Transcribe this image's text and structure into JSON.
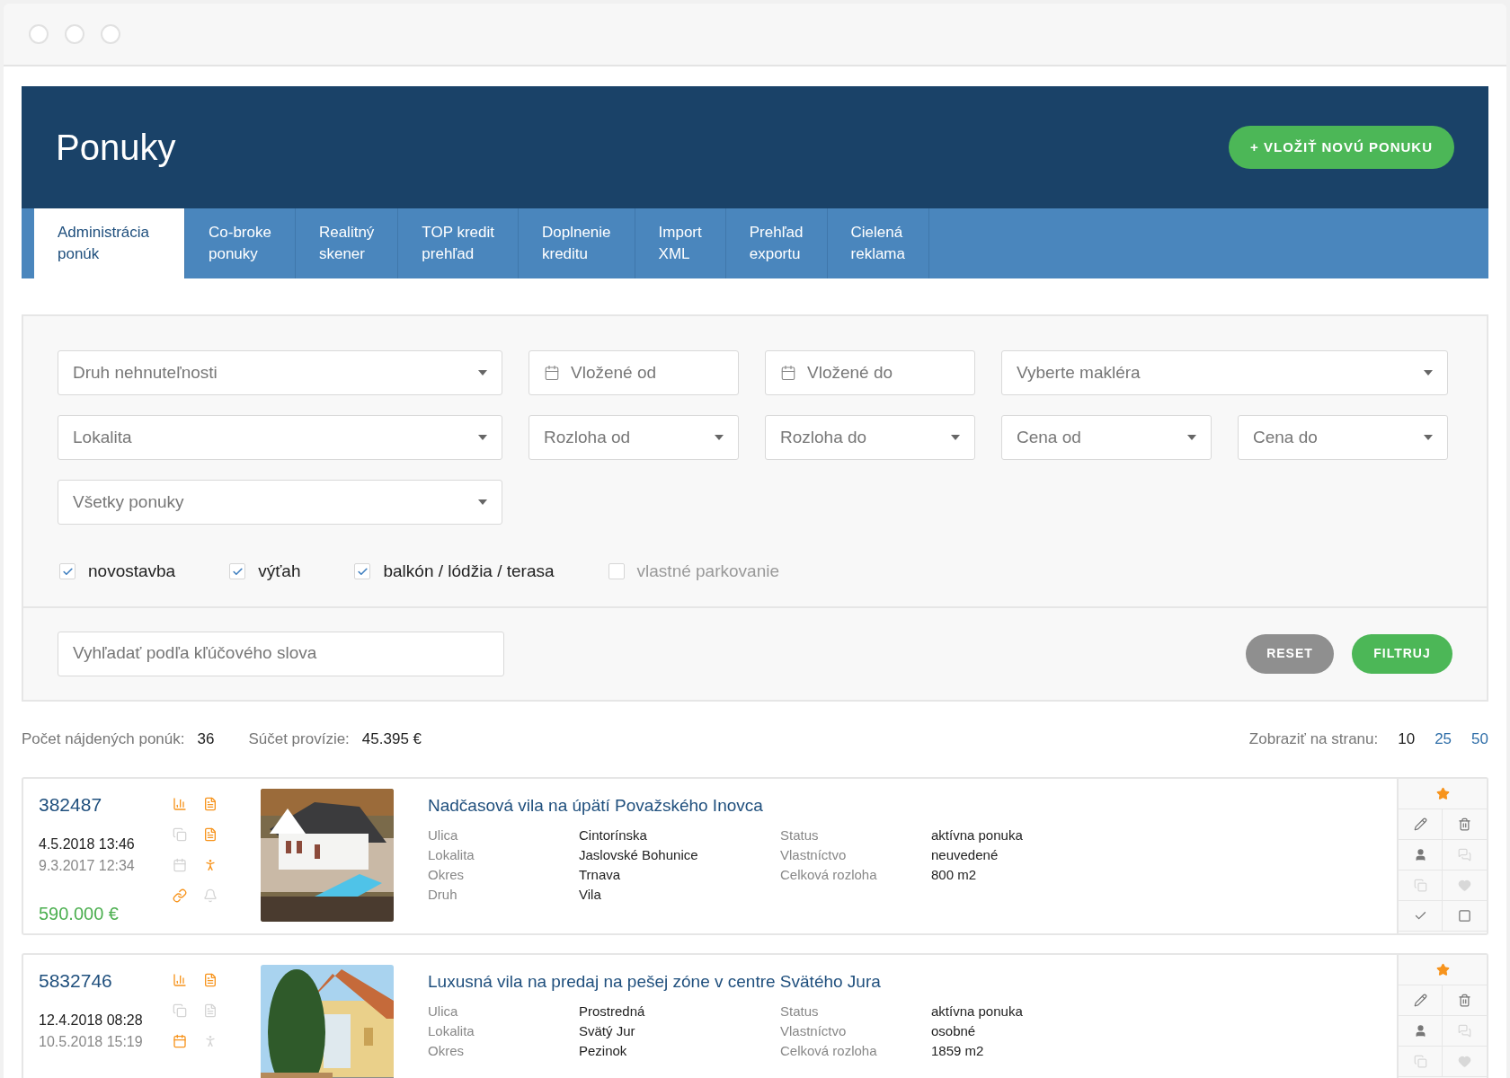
{
  "header": {
    "title": "Ponuky",
    "add_button": "+ VLOŽIŤ NOVÚ PONUKU"
  },
  "tabs": [
    {
      "label": "Administrácia\nponúk",
      "selected": true
    },
    {
      "label": "Co-broke\nponuky",
      "selected": false
    },
    {
      "label": "Realitný\nskener",
      "selected": false
    },
    {
      "label": "TOP kredit\nprehľad",
      "selected": false
    },
    {
      "label": "Doplnenie\nkreditu",
      "selected": false
    },
    {
      "label": "Import\nXML",
      "selected": false
    },
    {
      "label": "Prehľad\nexportu",
      "selected": false
    },
    {
      "label": "Cielená\nreklama",
      "selected": false
    }
  ],
  "filters": {
    "rows": [
      [
        {
          "kind": "select",
          "placeholder": "Druh nehnuteľnosti"
        },
        {
          "kind": "date",
          "placeholder": "Vložené od"
        },
        {
          "kind": "date",
          "placeholder": "Vložené do"
        },
        {
          "kind": "select",
          "placeholder": "Vyberte makléra"
        }
      ],
      [
        {
          "kind": "select",
          "placeholder": "Lokalita"
        },
        {
          "kind": "select",
          "placeholder": "Rozloha od"
        },
        {
          "kind": "select",
          "placeholder": "Rozloha do"
        },
        {
          "kind": "select",
          "placeholder": "Cena od"
        },
        {
          "kind": "select",
          "placeholder": "Cena do"
        }
      ],
      [
        {
          "kind": "select",
          "placeholder": "Všetky ponuky"
        }
      ]
    ],
    "checkboxes": [
      {
        "label": "novostavba",
        "checked": true
      },
      {
        "label": "výťah",
        "checked": true
      },
      {
        "label": "balkón / lódžia / terasa",
        "checked": true
      },
      {
        "label": "vlastné parkovanie",
        "checked": false
      }
    ],
    "search": {
      "placeholder": "Vyhľadať podľa kľúčového slova"
    },
    "reset_button": "RESET",
    "filter_button": "FILTRUJ"
  },
  "summary": {
    "count_label": "Počet nájdených ponúk:",
    "count": "36",
    "commission_label": "Súčet provízie:",
    "commission": "45.395 €",
    "per_page_label": "Zobraziť na stranu:",
    "per_page": [
      {
        "label": "10",
        "selected": true
      },
      {
        "label": "25",
        "selected": false
      },
      {
        "label": "50",
        "selected": false
      }
    ]
  },
  "listings": [
    {
      "id": "382487",
      "updated": "4.5.2018 13:46",
      "created": "9.3.2017 12:34",
      "price": "590.000 €",
      "icons": [
        {
          "kind": "chart",
          "active": true
        },
        {
          "kind": "document",
          "active": true
        },
        {
          "kind": "copy",
          "active": false
        },
        {
          "kind": "document",
          "active": true
        },
        {
          "kind": "calendar",
          "active": false
        },
        {
          "kind": "person",
          "active": true
        },
        {
          "kind": "link",
          "active": true
        },
        {
          "kind": "bell",
          "active": false
        }
      ],
      "title": "Nadčasová vila na úpätí Považského Inovca",
      "details_left": [
        {
          "label": "Ulica",
          "value": "Cintorínska"
        },
        {
          "label": "Lokalita",
          "value": "Jaslovské Bohunice"
        },
        {
          "label": "Okres",
          "value": "Trnava"
        },
        {
          "label": "Druh",
          "value": "Vila"
        }
      ],
      "details_right": [
        {
          "label": "Status",
          "value": "aktívna ponuka"
        },
        {
          "label": "Vlastníctvo",
          "value": "neuvedené"
        },
        {
          "label": "Celková rozloha",
          "value": "800 m2"
        }
      ],
      "actions": [
        {
          "kind": "star",
          "active": true
        },
        {
          "kind": "edit",
          "active": true
        },
        {
          "kind": "delete",
          "active": true
        },
        {
          "kind": "user",
          "active": true
        },
        {
          "kind": "comments",
          "active": false
        },
        {
          "kind": "copy",
          "active": false
        },
        {
          "kind": "heart",
          "active": false
        },
        {
          "kind": "check",
          "active": true
        },
        {
          "kind": "square",
          "active": true
        }
      ]
    },
    {
      "id": "5832746",
      "updated": "12.4.2018 08:28",
      "created": "10.5.2018 15:19",
      "icons": [
        {
          "kind": "chart",
          "active": true
        },
        {
          "kind": "document",
          "active": true
        },
        {
          "kind": "copy",
          "active": false
        },
        {
          "kind": "document",
          "active": false
        },
        {
          "kind": "calendar",
          "active": true
        },
        {
          "kind": "person",
          "active": false
        }
      ],
      "title": "Luxusná vila na predaj na pešej zóne v centre Svätého Jura",
      "details_left": [
        {
          "label": "Ulica",
          "value": "Prostredná"
        },
        {
          "label": "Lokalita",
          "value": "Svätý Jur"
        },
        {
          "label": "Okres",
          "value": "Pezinok"
        }
      ],
      "details_right": [
        {
          "label": "Status",
          "value": "aktívna ponuka"
        },
        {
          "label": "Vlastníctvo",
          "value": "osobné"
        },
        {
          "label": "Celková rozloha",
          "value": "1859 m2"
        }
      ],
      "actions": [
        {
          "kind": "star",
          "active": true
        },
        {
          "kind": "edit",
          "active": true
        },
        {
          "kind": "delete",
          "active": true
        },
        {
          "kind": "user",
          "active": true
        },
        {
          "kind": "comments",
          "active": false
        },
        {
          "kind": "copy",
          "active": false
        },
        {
          "kind": "heart",
          "active": false
        }
      ]
    }
  ]
}
